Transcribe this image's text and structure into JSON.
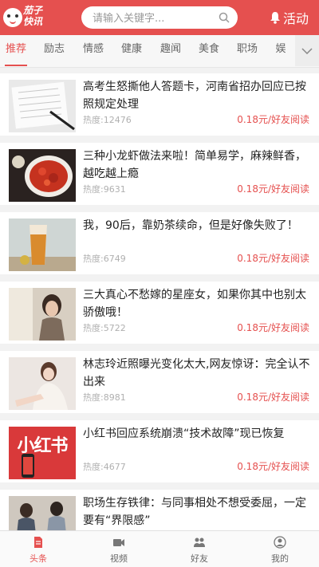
{
  "header": {
    "logo_line1": "茄子",
    "logo_line2": "快讯",
    "search_placeholder": "请输入关键字...",
    "activity_label": "活动",
    "search_icon": "search-icon",
    "bell_icon": "bell-icon"
  },
  "tabs": [
    "推荐",
    "励志",
    "情感",
    "健康",
    "趣闻",
    "美食",
    "职场",
    "娱"
  ],
  "active_tab": 0,
  "colors": {
    "accent": "#e5504f",
    "muted": "#b0b0b0"
  },
  "articles": [
    {
      "title": "高考生怒撕他人答题卡，河南省招办回应已按照规定处理",
      "heat": "热度:12476",
      "reward": "0.18元/好友阅读"
    },
    {
      "title": "三种小龙虾做法来啦！简单易学，麻辣鲜香，越吃越上瘾",
      "heat": "热度:9631",
      "reward": "0.18元/好友阅读"
    },
    {
      "title": "我，90后，靠奶茶续命，但是好像失败了！",
      "heat": "热度:6749",
      "reward": "0.18元/好友阅读"
    },
    {
      "title": "三大真心不愁嫁的星座女，如果你其中也别太骄傲哦！",
      "heat": "热度:5722",
      "reward": "0.18元/好友阅读"
    },
    {
      "title": "林志玲近照曝光变化太大,网友惊讶：完全认不出来",
      "heat": "热度:8981",
      "reward": "0.18元/好友阅读"
    },
    {
      "title": "小红书回应系统崩溃“技术故障”现已恢复",
      "heat": "热度:4677",
      "reward": "0.18元/好友阅读",
      "thumb_text": "小红书"
    },
    {
      "title": "职场生存铁律：与同事相处不想受委屈，一定要有“界限感”",
      "heat": "",
      "reward": ""
    }
  ],
  "bottom_nav": [
    {
      "label": "头条",
      "icon": "document-icon"
    },
    {
      "label": "视频",
      "icon": "video-icon"
    },
    {
      "label": "好友",
      "icon": "friends-icon"
    },
    {
      "label": "我的",
      "icon": "user-icon"
    }
  ],
  "active_nav": 0
}
